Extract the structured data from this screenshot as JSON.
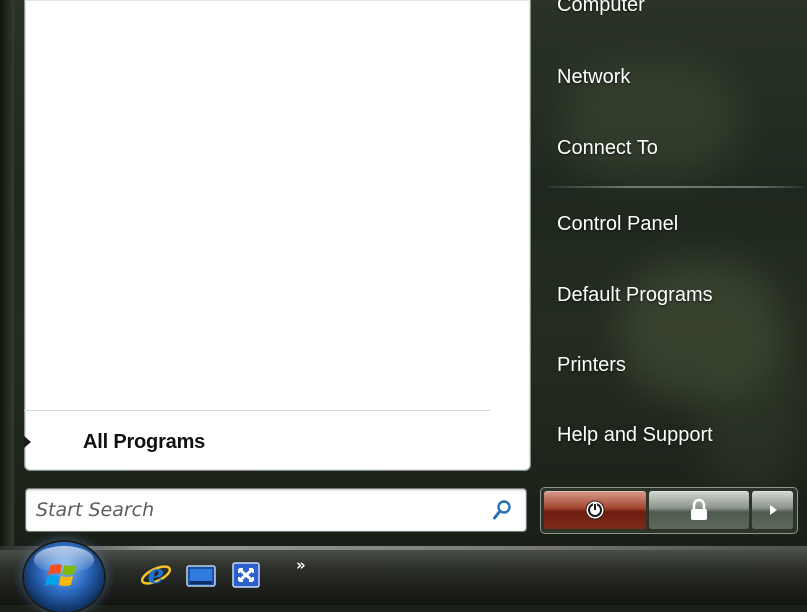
{
  "right_pane": {
    "items": [
      {
        "label": "Computer"
      },
      {
        "label": "Network"
      },
      {
        "label": "Connect To"
      },
      {
        "label": "Control Panel"
      },
      {
        "label": "Default Programs"
      },
      {
        "label": "Printers"
      },
      {
        "label": "Help and Support"
      }
    ]
  },
  "left_pane": {
    "all_programs_label": "All Programs"
  },
  "search": {
    "placeholder": "Start Search",
    "value": ""
  },
  "power": {
    "buttons": [
      {
        "icon": "power-icon"
      },
      {
        "icon": "lock-icon"
      },
      {
        "icon": "arrow-right-icon"
      }
    ]
  },
  "taskbar": {
    "quick_launch": [
      {
        "icon": "internet-explorer-icon"
      },
      {
        "icon": "show-desktop-icon"
      },
      {
        "icon": "switch-windows-icon"
      }
    ],
    "overflow_label": "»"
  },
  "colors": {
    "power_button": "#a34530",
    "ie_blue": "#1e73d2"
  }
}
